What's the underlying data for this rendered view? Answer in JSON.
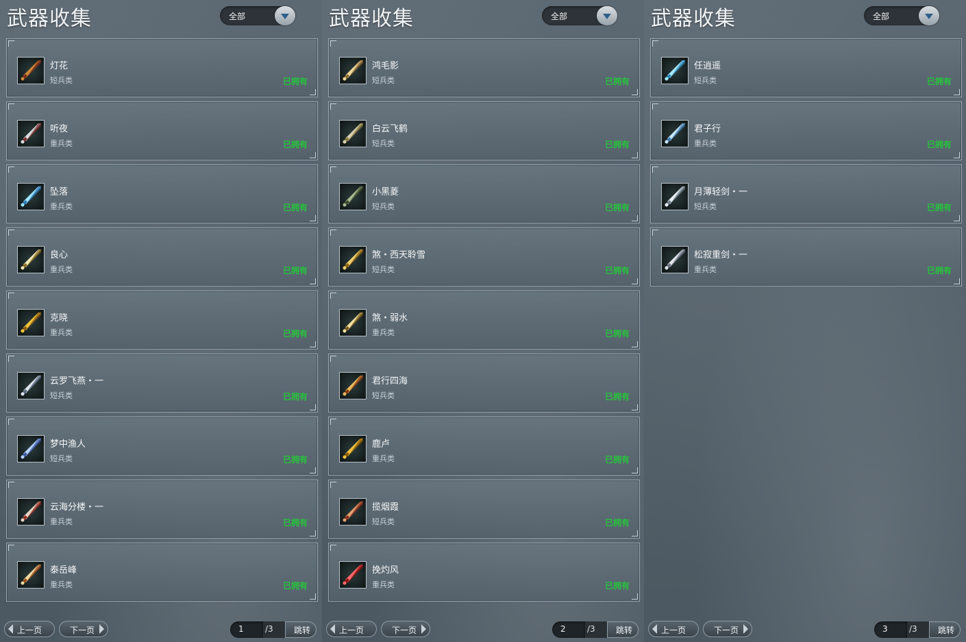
{
  "panels": [
    {
      "title": "武器收集",
      "filter": "全部",
      "items": [
        {
          "name": "灯花",
          "type": "短兵类",
          "status": "已拥有",
          "colors": [
            "#c98a3a",
            "#7a2a18"
          ]
        },
        {
          "name": "听夜",
          "type": "重兵类",
          "status": "已拥有",
          "colors": [
            "#d8dde0",
            "#7a2a2a"
          ]
        },
        {
          "name": "坠落",
          "type": "重兵类",
          "status": "已拥有",
          "colors": [
            "#9fe6ff",
            "#2a78b8"
          ]
        },
        {
          "name": "良心",
          "type": "重兵类",
          "status": "已拥有",
          "colors": [
            "#f2e7b8",
            "#8a6a20"
          ]
        },
        {
          "name": "克晓",
          "type": "重兵类",
          "status": "已拥有",
          "colors": [
            "#f1c43a",
            "#8a5a10"
          ]
        },
        {
          "name": "云罗飞燕・一",
          "type": "短兵类",
          "status": "已拥有",
          "colors": [
            "#dfe6ee",
            "#5a6a80"
          ]
        },
        {
          "name": "梦中渔人",
          "type": "短兵类",
          "status": "已拥有",
          "colors": [
            "#b8d0ff",
            "#3a5aa8"
          ]
        },
        {
          "name": "云海分楼・一",
          "type": "重兵类",
          "status": "已拥有",
          "colors": [
            "#e8d8c8",
            "#9a2a20"
          ]
        },
        {
          "name": "泰岳峰",
          "type": "重兵类",
          "status": "已拥有",
          "colors": [
            "#f0d8a0",
            "#9a4a18"
          ]
        }
      ],
      "pager": {
        "prev": "上一页",
        "next": "下一页",
        "page": "1",
        "total": "/3",
        "go": "跳转"
      }
    },
    {
      "title": "武器收集",
      "filter": "全部",
      "items": [
        {
          "name": "鸿毛影",
          "type": "短兵类",
          "status": "已拥有",
          "colors": [
            "#f0d89a",
            "#8a6a30"
          ]
        },
        {
          "name": "白云飞鹤",
          "type": "短兵类",
          "status": "已拥有",
          "colors": [
            "#d8d0b0",
            "#8a7a40"
          ]
        },
        {
          "name": "小黑菱",
          "type": "短兵类",
          "status": "已拥有",
          "colors": [
            "#a8b890",
            "#3a4a2a"
          ]
        },
        {
          "name": "煞・西天聆雪",
          "type": "短兵类",
          "status": "已拥有",
          "colors": [
            "#f0d070",
            "#8a6010"
          ]
        },
        {
          "name": "煞・弱水",
          "type": "重兵类",
          "status": "已拥有",
          "colors": [
            "#f2e0a0",
            "#7a5a18"
          ]
        },
        {
          "name": "君行四海",
          "type": "短兵类",
          "status": "已拥有",
          "colors": [
            "#e8b860",
            "#8a3a10"
          ]
        },
        {
          "name": "鹿卢",
          "type": "重兵类",
          "status": "已拥有",
          "colors": [
            "#f0c040",
            "#8a5a00"
          ]
        },
        {
          "name": "揽烟霞",
          "type": "短兵类",
          "status": "已拥有",
          "colors": [
            "#e0a070",
            "#8a2a18"
          ]
        },
        {
          "name": "挽灼风",
          "type": "重兵类",
          "status": "已拥有",
          "colors": [
            "#ff6a6a",
            "#8a1010"
          ]
        }
      ],
      "pager": {
        "prev": "上一页",
        "next": "下一页",
        "page": "2",
        "total": "/3",
        "go": "跳转"
      }
    },
    {
      "title": "武器收集",
      "filter": "全部",
      "items": [
        {
          "name": "任逍遥",
          "type": "短兵类",
          "status": "已拥有",
          "colors": [
            "#a8e8ff",
            "#2a88b8"
          ]
        },
        {
          "name": "君子行",
          "type": "重兵类",
          "status": "已拥有",
          "colors": [
            "#c8e8ff",
            "#3a78a8"
          ]
        },
        {
          "name": "月薄轻剑・一",
          "type": "短兵类",
          "status": "已拥有",
          "colors": [
            "#e8eef2",
            "#6a7a88"
          ]
        },
        {
          "name": "松寂重剑・一",
          "type": "重兵类",
          "status": "已拥有",
          "colors": [
            "#e0e6ea",
            "#6a7480"
          ]
        }
      ],
      "pager": {
        "prev": "上一页",
        "next": "下一页",
        "page": "3",
        "total": "/3",
        "go": "跳转"
      }
    }
  ]
}
